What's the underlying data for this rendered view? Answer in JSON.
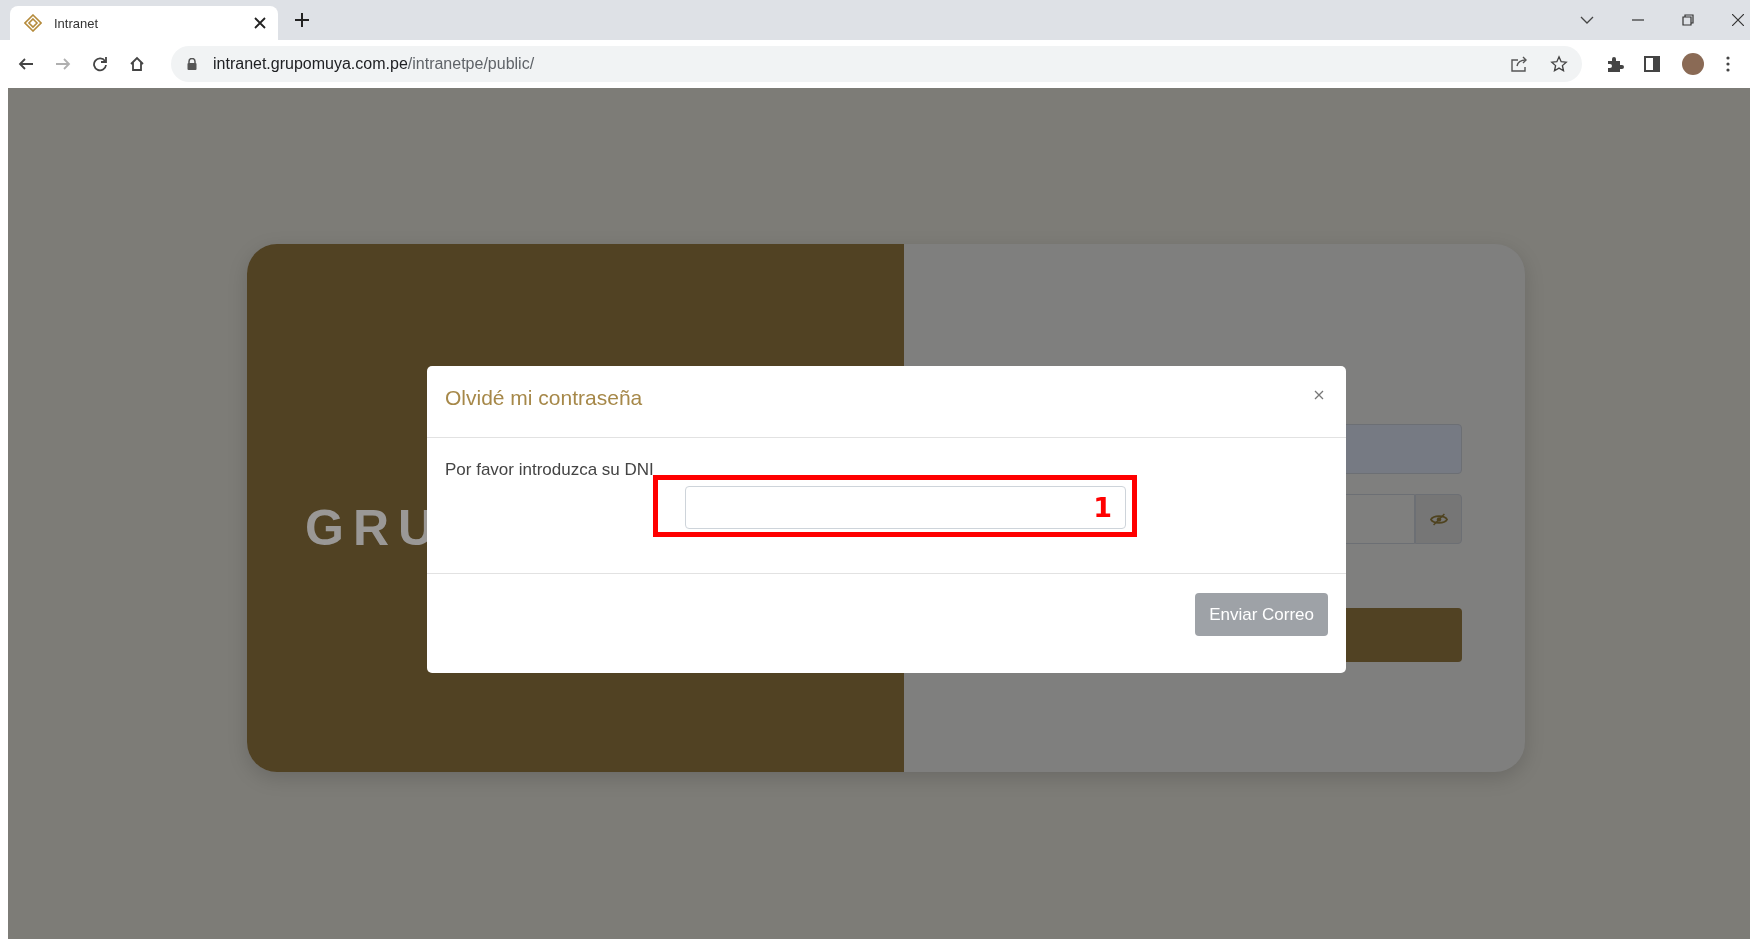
{
  "browser": {
    "tab": {
      "title": "Intranet",
      "selected": true
    },
    "nav_buttons": [
      {
        "kind": "back",
        "disabled": false
      },
      {
        "kind": "forward",
        "disabled": true
      },
      {
        "kind": "reload",
        "disabled": false
      },
      {
        "kind": "home",
        "disabled": false
      }
    ],
    "address": {
      "host": "intranet.grupomuya.com.pe",
      "path": "/intranetpe/public/"
    }
  },
  "login_card": {
    "logo_text": "GRU"
  },
  "modal": {
    "title": "Olvidé mi contraseña",
    "label": "Por favor introduzca su DNI",
    "annotation": "1",
    "button": "Enviar Correo",
    "button_disabled": true
  }
}
